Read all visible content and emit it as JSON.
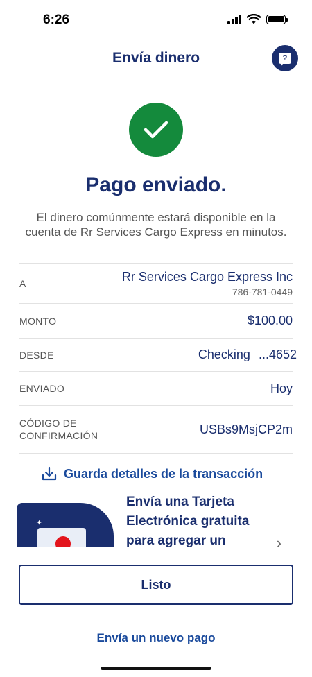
{
  "status_bar": {
    "time": "6:26"
  },
  "header": {
    "title": "Envía dinero",
    "help_icon_label": "?"
  },
  "result": {
    "headline": "Pago enviado.",
    "message": "El dinero comúnmente estará disponible en la cuenta de Rr Services Cargo Express en minutos."
  },
  "details": {
    "recipient_label": "A",
    "recipient_name": "Rr Services Cargo Express Inc",
    "recipient_phone": "786-781-0449",
    "amount_label": "MONTO",
    "amount_value": "$100.00",
    "from_label": "DESDE",
    "from_account": "Checking",
    "from_last4": "...4652",
    "sent_label": "ENVIADO",
    "sent_value": "Hoy",
    "confirmation_label": "CÓDIGO DE CONFIRMACIÓN",
    "confirmation_value": "USBs9MsjCP2m"
  },
  "actions": {
    "save_details": "Guarda detalles de la transacción",
    "done": "Listo",
    "new_payment": "Envía un nuevo pago"
  },
  "promo": {
    "text": "Envía una Tarjeta Electrónica gratuita para agregar un"
  },
  "colors": {
    "brand_navy": "#1a2e6e",
    "link_blue": "#1a4a9c",
    "success_green": "#148a3c",
    "accent_red": "#e3141c"
  },
  "icons": [
    "signal-icon",
    "wifi-icon",
    "battery-icon",
    "help-chat-icon",
    "checkmark-icon",
    "download-icon",
    "chevron-right-icon"
  ]
}
